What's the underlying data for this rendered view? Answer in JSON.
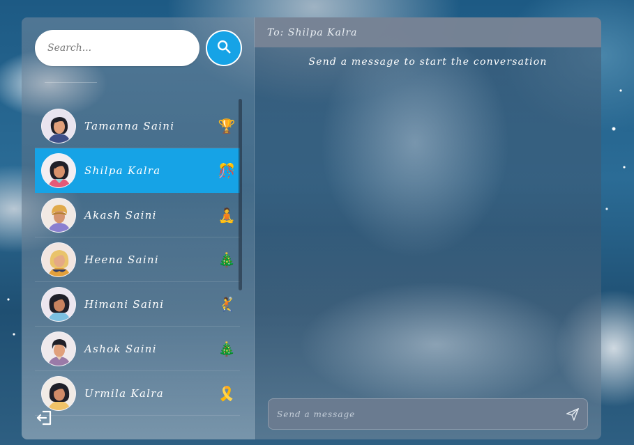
{
  "search": {
    "placeholder": "Search..."
  },
  "chat": {
    "header": "To: Shilpa Kalra",
    "empty_message": "Send a message to start the conversation",
    "composer_placeholder": "Send a message"
  },
  "contacts": [
    {
      "name": "Tamanna Saini",
      "emoji": "🏆",
      "active": false
    },
    {
      "name": "Shilpa Kalra",
      "emoji": "🎊",
      "active": true
    },
    {
      "name": "Akash Saini",
      "emoji": "🧘",
      "active": false
    },
    {
      "name": "Heena Saini",
      "emoji": "🎄",
      "active": false
    },
    {
      "name": "Himani Saini",
      "emoji": "🤾",
      "active": false
    },
    {
      "name": "Ashok Saini",
      "emoji": "🎄",
      "active": false
    },
    {
      "name": "Urmila Kalra",
      "emoji": "🎗️",
      "active": false
    }
  ],
  "icons": {
    "search": "search-icon",
    "logout": "logout-icon",
    "send": "send-icon"
  },
  "colors": {
    "accent": "#16a3e6",
    "header_bg": "#78849a"
  }
}
